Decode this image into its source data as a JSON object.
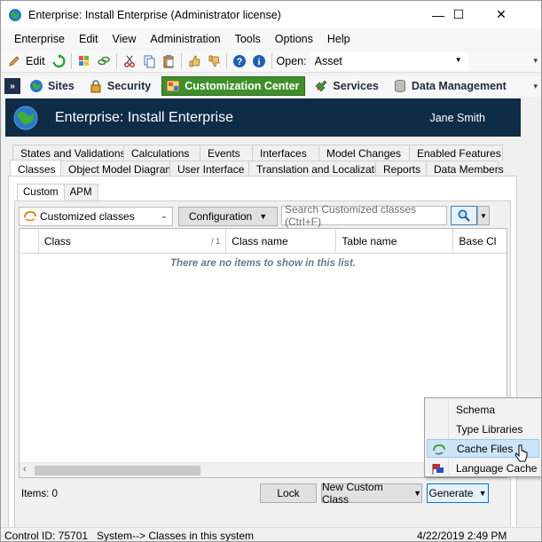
{
  "window": {
    "title": "Enterprise: Install Enterprise (Administrator license)",
    "minimize_glyph": "—",
    "maximize_glyph": "☐",
    "close_glyph": "✕"
  },
  "menubar": [
    "Enterprise",
    "Edit",
    "View",
    "Administration",
    "Tools",
    "Options",
    "Help"
  ],
  "toolbar": {
    "edit_label": "Edit",
    "open_label": "Open:",
    "open_value": "Asset"
  },
  "navbar": {
    "items": [
      {
        "label": "Sites",
        "icon": "globe-icon"
      },
      {
        "label": "Security",
        "icon": "lock-icon"
      },
      {
        "label": "Customization Center",
        "icon": "customization-icon",
        "active": true
      },
      {
        "label": "Services",
        "icon": "services-icon"
      },
      {
        "label": "Data Management",
        "icon": "database-icon"
      }
    ]
  },
  "banner": {
    "title": "Enterprise: Install Enterprise",
    "user": "Jane Smith"
  },
  "tabs": {
    "row1": [
      "States and Validations",
      "Calculations",
      "Events",
      "Interfaces",
      "Model Changes",
      "Enabled Features"
    ],
    "row2": [
      "Classes",
      "Object Model Diagrams",
      "User Interface",
      "Translation and Localization",
      "Reports",
      "Data Members"
    ],
    "active": "Classes"
  },
  "subtabs": [
    "Custom",
    "APM"
  ],
  "filters": {
    "class_filter": "Customized classes",
    "configuration_label": "Configuration",
    "search_placeholder": "Search Customized classes  (Ctrl+F)"
  },
  "grid": {
    "columns": [
      "Class",
      "Class name",
      "Table name",
      "Base Cl"
    ],
    "sort_indicator": "/ 1",
    "empty_message": "There are no items to show in this list."
  },
  "footer": {
    "items_label": "Items: 0",
    "lock_label": "Lock",
    "new_custom_class_label": "New Custom Class",
    "generate_label": "Generate"
  },
  "generate_menu": [
    {
      "label": "Schema",
      "icon": ""
    },
    {
      "label": "Type Libraries",
      "icon": ""
    },
    {
      "label": "Cache Files",
      "icon": "cache-files-icon",
      "highlighted": true
    },
    {
      "label": "Language Cache",
      "icon": "language-flag-icon"
    }
  ],
  "statusbar": {
    "control_id": "Control ID: 75701",
    "path": "System--> Classes in this system",
    "datetime": "4/22/2019 2:49 PM"
  },
  "colors": {
    "banner_bg": "#0f2c47",
    "active_nav_bg": "#3f8f2b",
    "menu_highlight": "#cce4f7"
  }
}
